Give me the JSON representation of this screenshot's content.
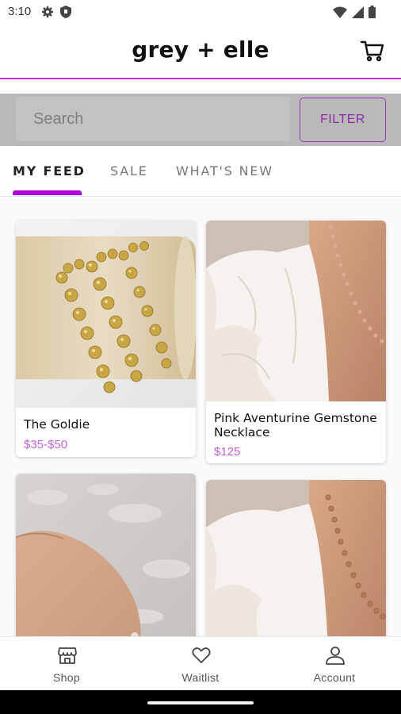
{
  "status_bar": {
    "time": "3:10",
    "left_icons": [
      "gear-icon",
      "shield-icon"
    ],
    "right_icons": [
      "wifi-icon",
      "signal-icon",
      "battery-icon"
    ]
  },
  "header": {
    "title": "grey + elle",
    "cart_icon": "cart-icon",
    "accent_color": "#c62ee0"
  },
  "search": {
    "placeholder": "Search",
    "filter_label": "FILTER"
  },
  "tabs": [
    {
      "label": "MY FEED",
      "active": true
    },
    {
      "label": "SALE",
      "active": false
    },
    {
      "label": "WHAT'S NEW",
      "active": false
    }
  ],
  "products": [
    {
      "title": "The Goldie",
      "price": "$35-$50",
      "image": "gold-bead-bracelets-photo"
    },
    {
      "title": "Pink Aventurine Gemstone Necklace",
      "price": "$125",
      "image": "pink-gemstone-necklace-photo"
    },
    {
      "title": "",
      "price": "",
      "image": "wrist-on-fur-photo"
    },
    {
      "title": "",
      "price": "",
      "image": "beaded-necklace-photo"
    }
  ],
  "bottom_nav": [
    {
      "label": "Shop",
      "icon": "store-icon"
    },
    {
      "label": "Waitlist",
      "icon": "heart-icon"
    },
    {
      "label": "Account",
      "icon": "person-icon"
    }
  ],
  "colors": {
    "brand_purple": "#b000dc",
    "price_purple": "#c062d6"
  }
}
